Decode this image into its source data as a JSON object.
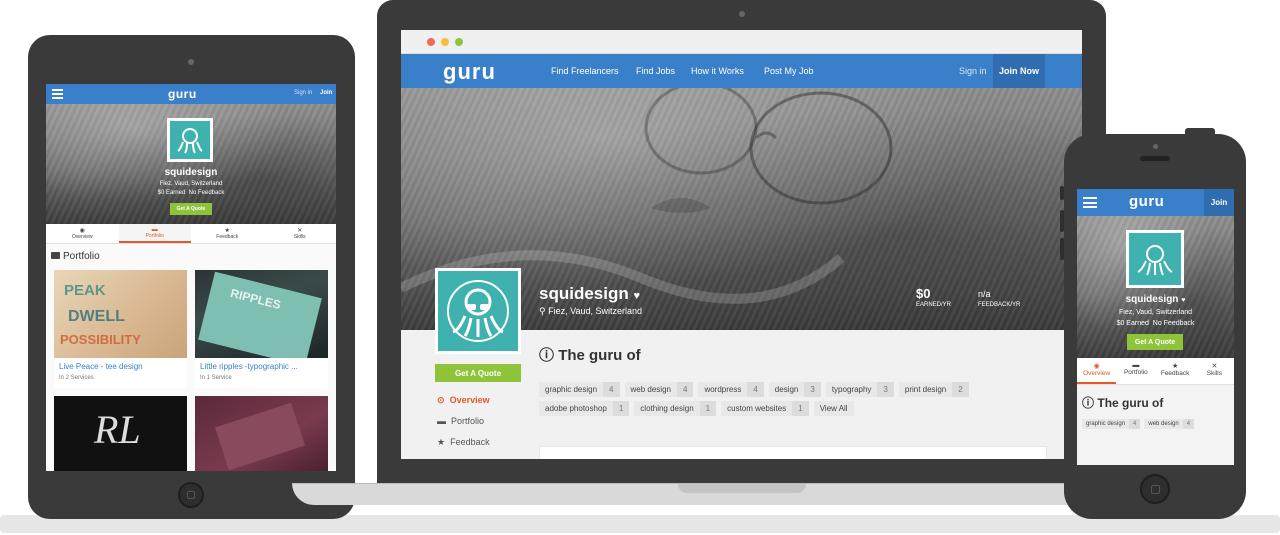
{
  "brand": {
    "logo_text": "guru",
    "accent": "#3a7fc9",
    "quote_color": "#8fc43a",
    "teal": "#3fb1ae"
  },
  "laptop": {
    "nav": {
      "links": [
        "Find Freelancers",
        "Find Jobs",
        "How it Works",
        "Post My Job"
      ],
      "sign_in": "Sign in",
      "join": "Join Now"
    },
    "profile": {
      "name": "squidesign",
      "location": "Fiez, Vaud, Switzerland",
      "earned_value": "$0",
      "earned_label": "EARNED/YR",
      "feedback_value": "n/a",
      "feedback_label": "FEEDBACK/YR",
      "quote_button": "Get A Quote",
      "guru_heading": "The guru of",
      "side_menu": [
        "Overview",
        "Portfolio",
        "Feedback"
      ],
      "tags": [
        {
          "label": "graphic design",
          "count": "4"
        },
        {
          "label": "web design",
          "count": "4"
        },
        {
          "label": "wordpress",
          "count": "4"
        },
        {
          "label": "design",
          "count": "3"
        },
        {
          "label": "typography",
          "count": "3"
        },
        {
          "label": "print design",
          "count": "2"
        },
        {
          "label": "adobe photoshop",
          "count": "1"
        },
        {
          "label": "clothing design",
          "count": "1"
        },
        {
          "label": "custom websites",
          "count": "1"
        }
      ],
      "view_all": "View All"
    }
  },
  "tablet": {
    "nav": {
      "sign_in": "Sign in",
      "join": "Join"
    },
    "profile": {
      "name": "squidesign",
      "location": "Fiez, Vaud, Switzerland",
      "earned": "$0 Earned",
      "feedback": "No Feedback",
      "quote_button": "Get A Quote"
    },
    "tabs": [
      "Overview",
      "Portfolio",
      "Feedback",
      "Skills"
    ],
    "portfolio_heading": "Portfolio",
    "items": [
      {
        "title": "Live Peace - tee design",
        "sub": "In 2 Services"
      },
      {
        "title": "Little ripples -typographic ...",
        "sub": "In 1 Service"
      }
    ]
  },
  "phone": {
    "nav": {
      "join": "Join"
    },
    "profile": {
      "name": "squidesign",
      "location": "Fiez, Vaud, Switzerland",
      "earned": "$0 Earned",
      "feedback": "No Feedback",
      "quote_button": "Get A Quote"
    },
    "tabs": [
      "Overview",
      "Portfolio",
      "Feedback",
      "Skills"
    ],
    "guru_heading": "The guru of",
    "tags": [
      {
        "label": "graphic design",
        "count": "4"
      },
      {
        "label": "web design",
        "count": "4"
      }
    ]
  }
}
